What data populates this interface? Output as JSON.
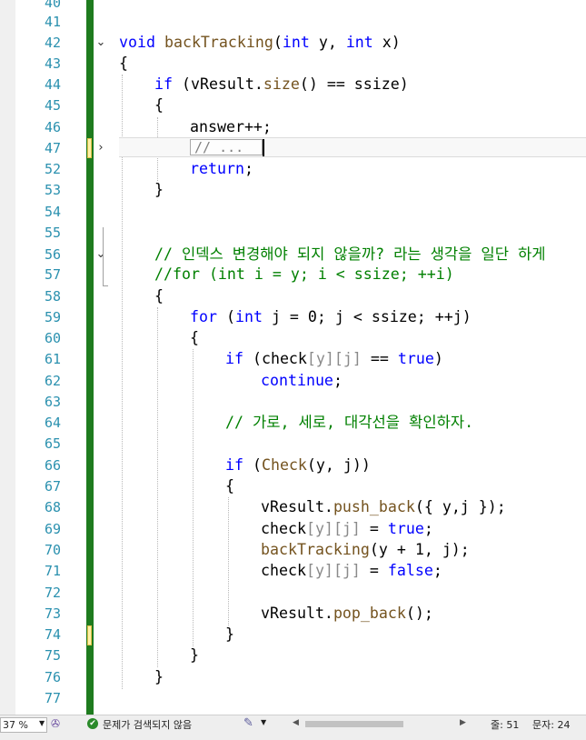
{
  "editor": {
    "line_numbers": [
      "40",
      "41",
      "42",
      "43",
      "44",
      "45",
      "46",
      "47",
      "52",
      "53",
      "54",
      "55",
      "56",
      "57",
      "58",
      "59",
      "60",
      "61",
      "62",
      "63",
      "64",
      "65",
      "66",
      "67",
      "68",
      "69",
      "70",
      "71",
      "72",
      "73",
      "74",
      "75",
      "76",
      "77"
    ],
    "code": {
      "l42": {
        "kw_void": "void",
        "fn": "backTracking",
        "p1": "(",
        "t1": "int",
        "a1": " y, ",
        "t2": "int",
        "a2": " x)"
      },
      "l43": "{",
      "l44": {
        "kw": "if",
        "a": " (vResult.",
        "fn": "size",
        "b": "() == ssize)"
      },
      "l45": "{",
      "l46": "answer++;",
      "l47_collapsed": "// ...",
      "l52": {
        "kw": "return",
        "a": ";"
      },
      "l53": "}",
      "l56": "// 인덱스 변경해야 되지 않을까? 라는 생각을 일단 하게",
      "l57": "//for (int i = y; i < ssize; ++i)",
      "l58": "{",
      "l59": {
        "kw": "for",
        "a": " (",
        "t": "int",
        "b": " j = 0; j < ssize; ++j)"
      },
      "l60": "{",
      "l61": {
        "kw": "if",
        "a": " (check",
        "p1": "[y]",
        "p2": "[j]",
        "b": " == ",
        "v": "true",
        ")": ")"
      },
      "l62": {
        "kw": "continue",
        "a": ";"
      },
      "l64": "// 가로, 세로, 대각선을 확인하자.",
      "l66": {
        "kw": "if",
        "a": " (",
        "fn": "Check",
        "b": "(y, j))"
      },
      "l67": "{",
      "l68": {
        "a": "vResult.",
        "fn": "push_back",
        "b": "({ y,j });"
      },
      "l69": {
        "a": "check",
        "p1": "[y]",
        "p2": "[j]",
        "b": " = ",
        "v": "true",
        "c": ";"
      },
      "l70": {
        "fn": "backTracking",
        "a": "(y + 1, j);"
      },
      "l71": {
        "a": "check",
        "p1": "[y]",
        "p2": "[j]",
        "b": " = ",
        "v": "false",
        "c": ";"
      },
      "l73": {
        "a": "vResult.",
        "fn": "pop_back",
        "b": "();"
      },
      "l74": "}",
      "l75": "}",
      "l76": "}"
    },
    "fold_glyphs": {
      "open": "⌄",
      "collapsed": "›"
    }
  },
  "statusbar": {
    "zoom": "37 %",
    "issues_text": "문제가 검색되지 않음",
    "line_label": "줄: 51",
    "col_label": "문자: 24"
  },
  "colors": {
    "keyword": "#0000ff",
    "function": "#74531f",
    "comment": "#008000",
    "line_number": "#2b91af",
    "change_margin": "#1e7b1e"
  }
}
